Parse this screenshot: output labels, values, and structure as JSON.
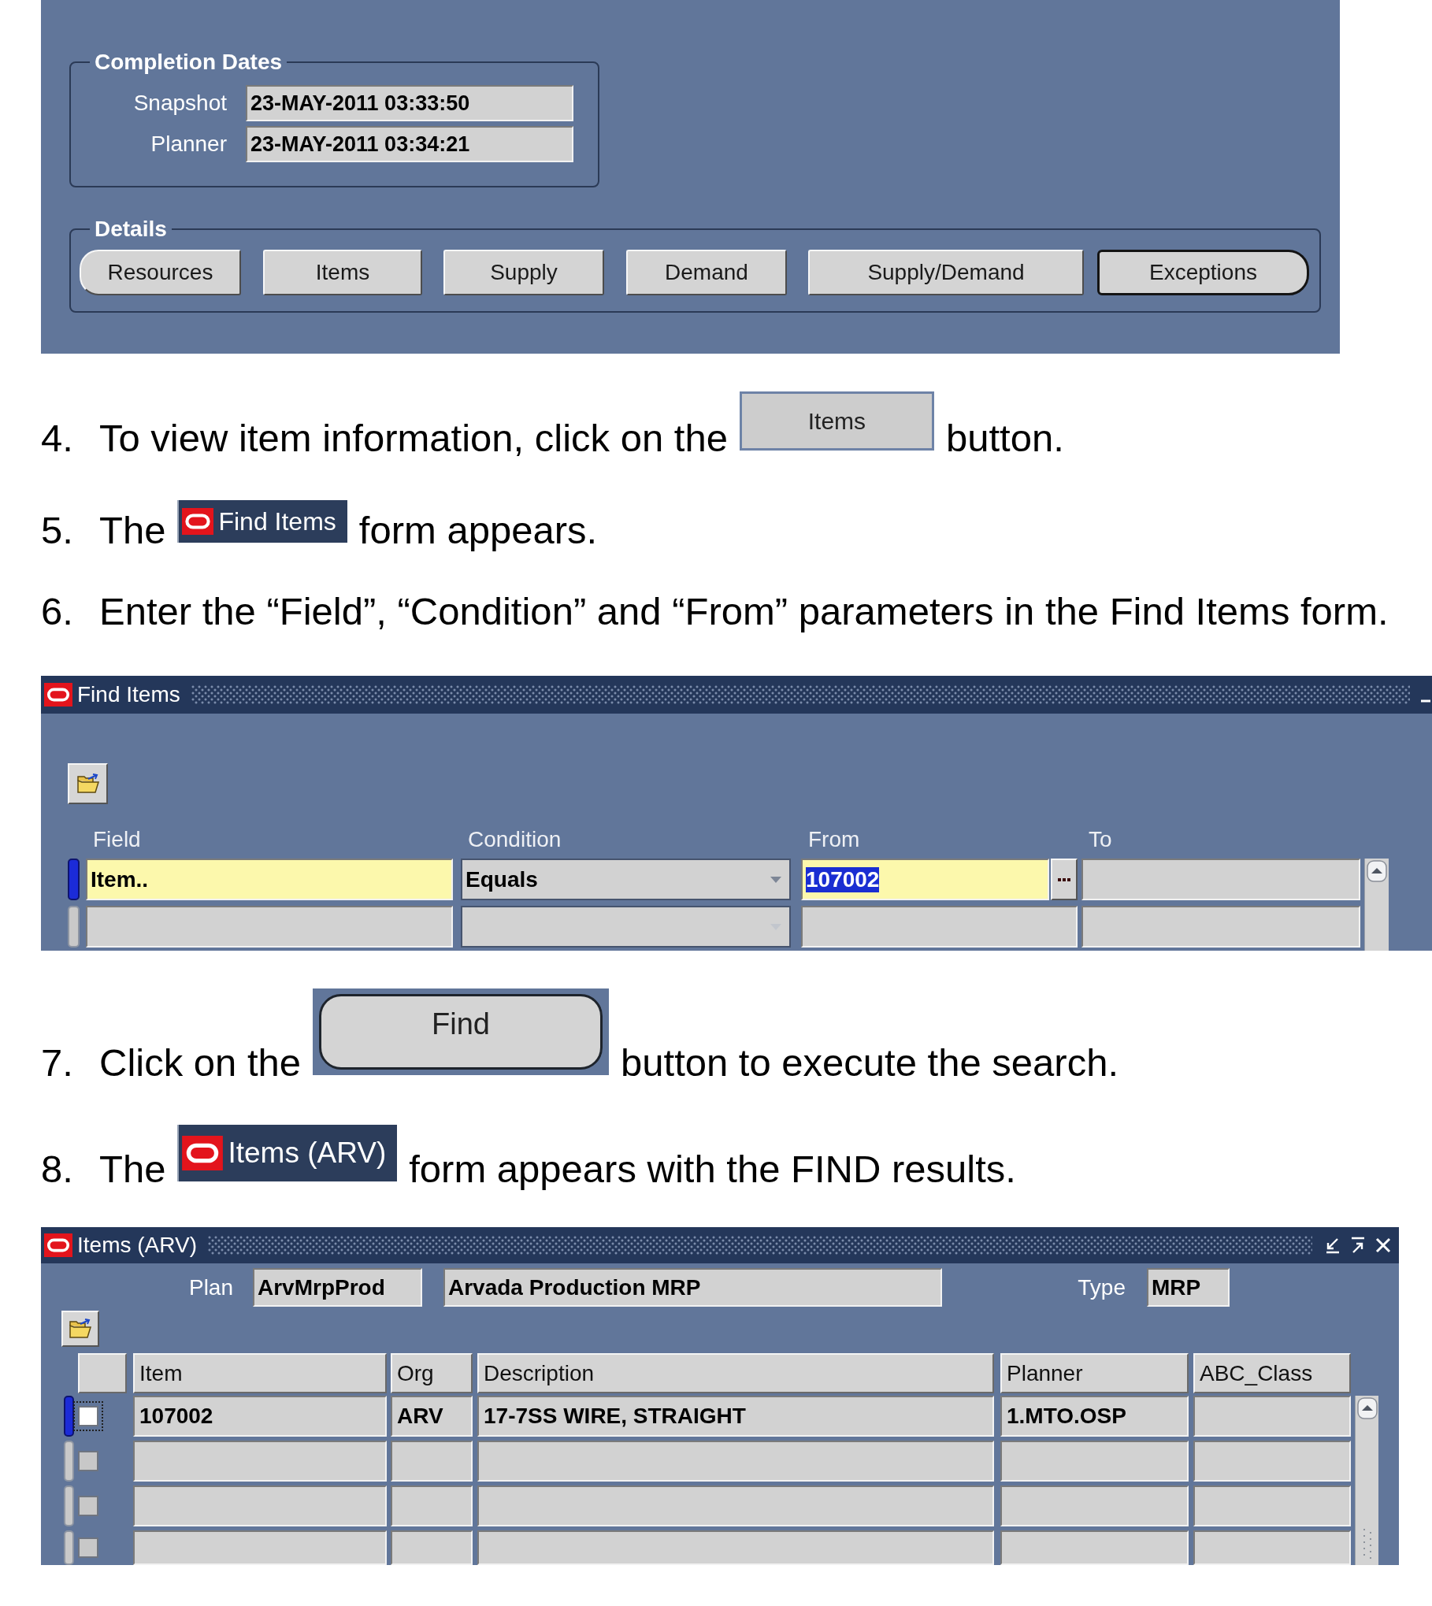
{
  "details_form": {
    "completion_dates": {
      "title": "Completion Dates",
      "fields": [
        {
          "label": "Snapshot",
          "value": "23-MAY-2011 03:33:50"
        },
        {
          "label": "Planner",
          "value": "23-MAY-2011 03:34:21"
        }
      ]
    },
    "details": {
      "title": "Details",
      "buttons": [
        {
          "label": "Resources",
          "default": false
        },
        {
          "label": "Items",
          "default": false
        },
        {
          "label": "Supply",
          "default": false
        },
        {
          "label": "Demand",
          "default": false
        },
        {
          "label": "Supply/Demand",
          "default": false
        },
        {
          "label": "Exceptions",
          "default": true
        }
      ]
    }
  },
  "steps_before": [
    {
      "number": "4.",
      "parts": [
        {
          "kind": "text",
          "text": "To view item information, click on the"
        },
        {
          "kind": "button",
          "label": "Items",
          "default": false
        },
        {
          "kind": "text",
          "text": "button."
        }
      ]
    },
    {
      "number": "5.",
      "parts": [
        {
          "kind": "text",
          "text": "The"
        },
        {
          "kind": "window_title",
          "title": "Find Items"
        },
        {
          "kind": "text",
          "text": "form appears."
        }
      ]
    },
    {
      "number": "6.",
      "parts": [
        {
          "kind": "text",
          "text": "Enter the “Field”, “Condition” and “From” parameters in the Find Items form."
        }
      ]
    }
  ],
  "find_items_form": {
    "title": "Find Items",
    "columns": [
      "Field",
      "Condition",
      "From",
      "To"
    ],
    "rows": [
      {
        "current": true,
        "cells": [
          {
            "kind": "text",
            "value": "Item..",
            "required": true,
            "highlighted": false
          },
          {
            "kind": "dropdown",
            "value": "Equals",
            "required": false,
            "highlighted": false
          },
          {
            "kind": "lov",
            "value": "107002",
            "required": true,
            "highlighted": true
          },
          {
            "kind": "text",
            "required": false
          }
        ]
      },
      {
        "current": false,
        "cells": [
          {
            "kind": "text",
            "required": false
          },
          {
            "kind": "dropdown",
            "required": false
          },
          {
            "kind": "text",
            "required": false
          },
          {
            "kind": "text",
            "required": false
          }
        ]
      }
    ]
  },
  "steps_after": [
    {
      "number": "7.",
      "parts": [
        {
          "kind": "text",
          "text": "Click on the"
        },
        {
          "kind": "button",
          "label": "Find",
          "default": true
        },
        {
          "kind": "text",
          "text": "button to execute the search."
        }
      ]
    },
    {
      "number": "8.",
      "parts": [
        {
          "kind": "text",
          "text": "The"
        },
        {
          "kind": "window_title",
          "title": "Items (ARV)"
        },
        {
          "kind": "text",
          "text": "form appears with the FIND results."
        }
      ]
    }
  ],
  "items_form": {
    "title": "Items (ARV)",
    "plan_label": "Plan",
    "plan": "ArvMrpProd",
    "plan_description": "Arvada Production MRP",
    "type_label": "Type",
    "type": "MRP",
    "columns": [
      "Item",
      "Org",
      "Description",
      "Planner",
      "ABC_Class"
    ],
    "rows": [
      {
        "current": true,
        "checked": false,
        "item": "107002",
        "org": "ARV",
        "description": "17-7SS WIRE, STRAIGHT",
        "planner": "1.MTO.OSP"
      },
      {
        "current": false,
        "checked": false
      },
      {
        "current": false,
        "checked": false
      },
      {
        "current": false,
        "checked": false
      }
    ]
  }
}
